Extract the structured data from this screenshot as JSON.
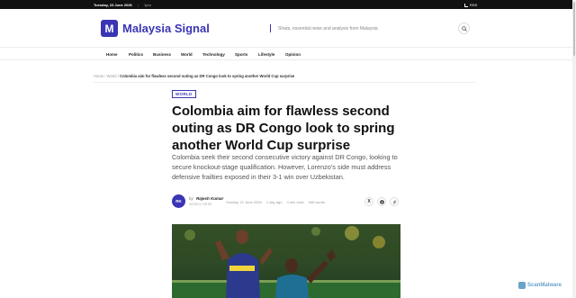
{
  "topbar": {
    "date": "Tuesday, 23 June 2026",
    "separator": "|",
    "time": "1pm",
    "rss_label": "RSS"
  },
  "header": {
    "logo_letter": "M",
    "site_name": "Malaysia Signal",
    "tagline": "Sharp, essential news and analysis from Malaysia",
    "search_icon": "search-icon"
  },
  "nav": {
    "items": [
      "Home",
      "Politics",
      "Business",
      "World",
      "Technology",
      "Sports",
      "Lifestyle",
      "Opinion"
    ]
  },
  "breadcrumb": {
    "home": "Home",
    "sep1": "/",
    "section": "World",
    "sep2": "/",
    "current": "Colombia aim for flawless second outing as DR Congo look to spring another World Cup surprise"
  },
  "article": {
    "category": "WORLD",
    "headline": "Colombia aim for flawless second outing as DR Congo look to spring another World Cup surprise",
    "deck": "Colombia seek their second consecutive victory against DR Congo, looking to secure knockout-stage qualification. However, Lorenzo's side must address defensive frailties exposed in their 3-1 win over Uzbekistan.",
    "author_initials": "RK",
    "by": "by",
    "author": "Rajesh Kumar",
    "author_role": "WORLD DESK",
    "date": "Sunday, 21 June 2026",
    "ago": "1 day ago",
    "read_time": "4 min read",
    "words": "940 words",
    "share_icons": [
      "x-icon",
      "facebook-icon",
      "link-icon"
    ]
  },
  "watermark": "ScanMalware",
  "colors": {
    "brand": "#3a35b4",
    "topbar": "#111111"
  }
}
